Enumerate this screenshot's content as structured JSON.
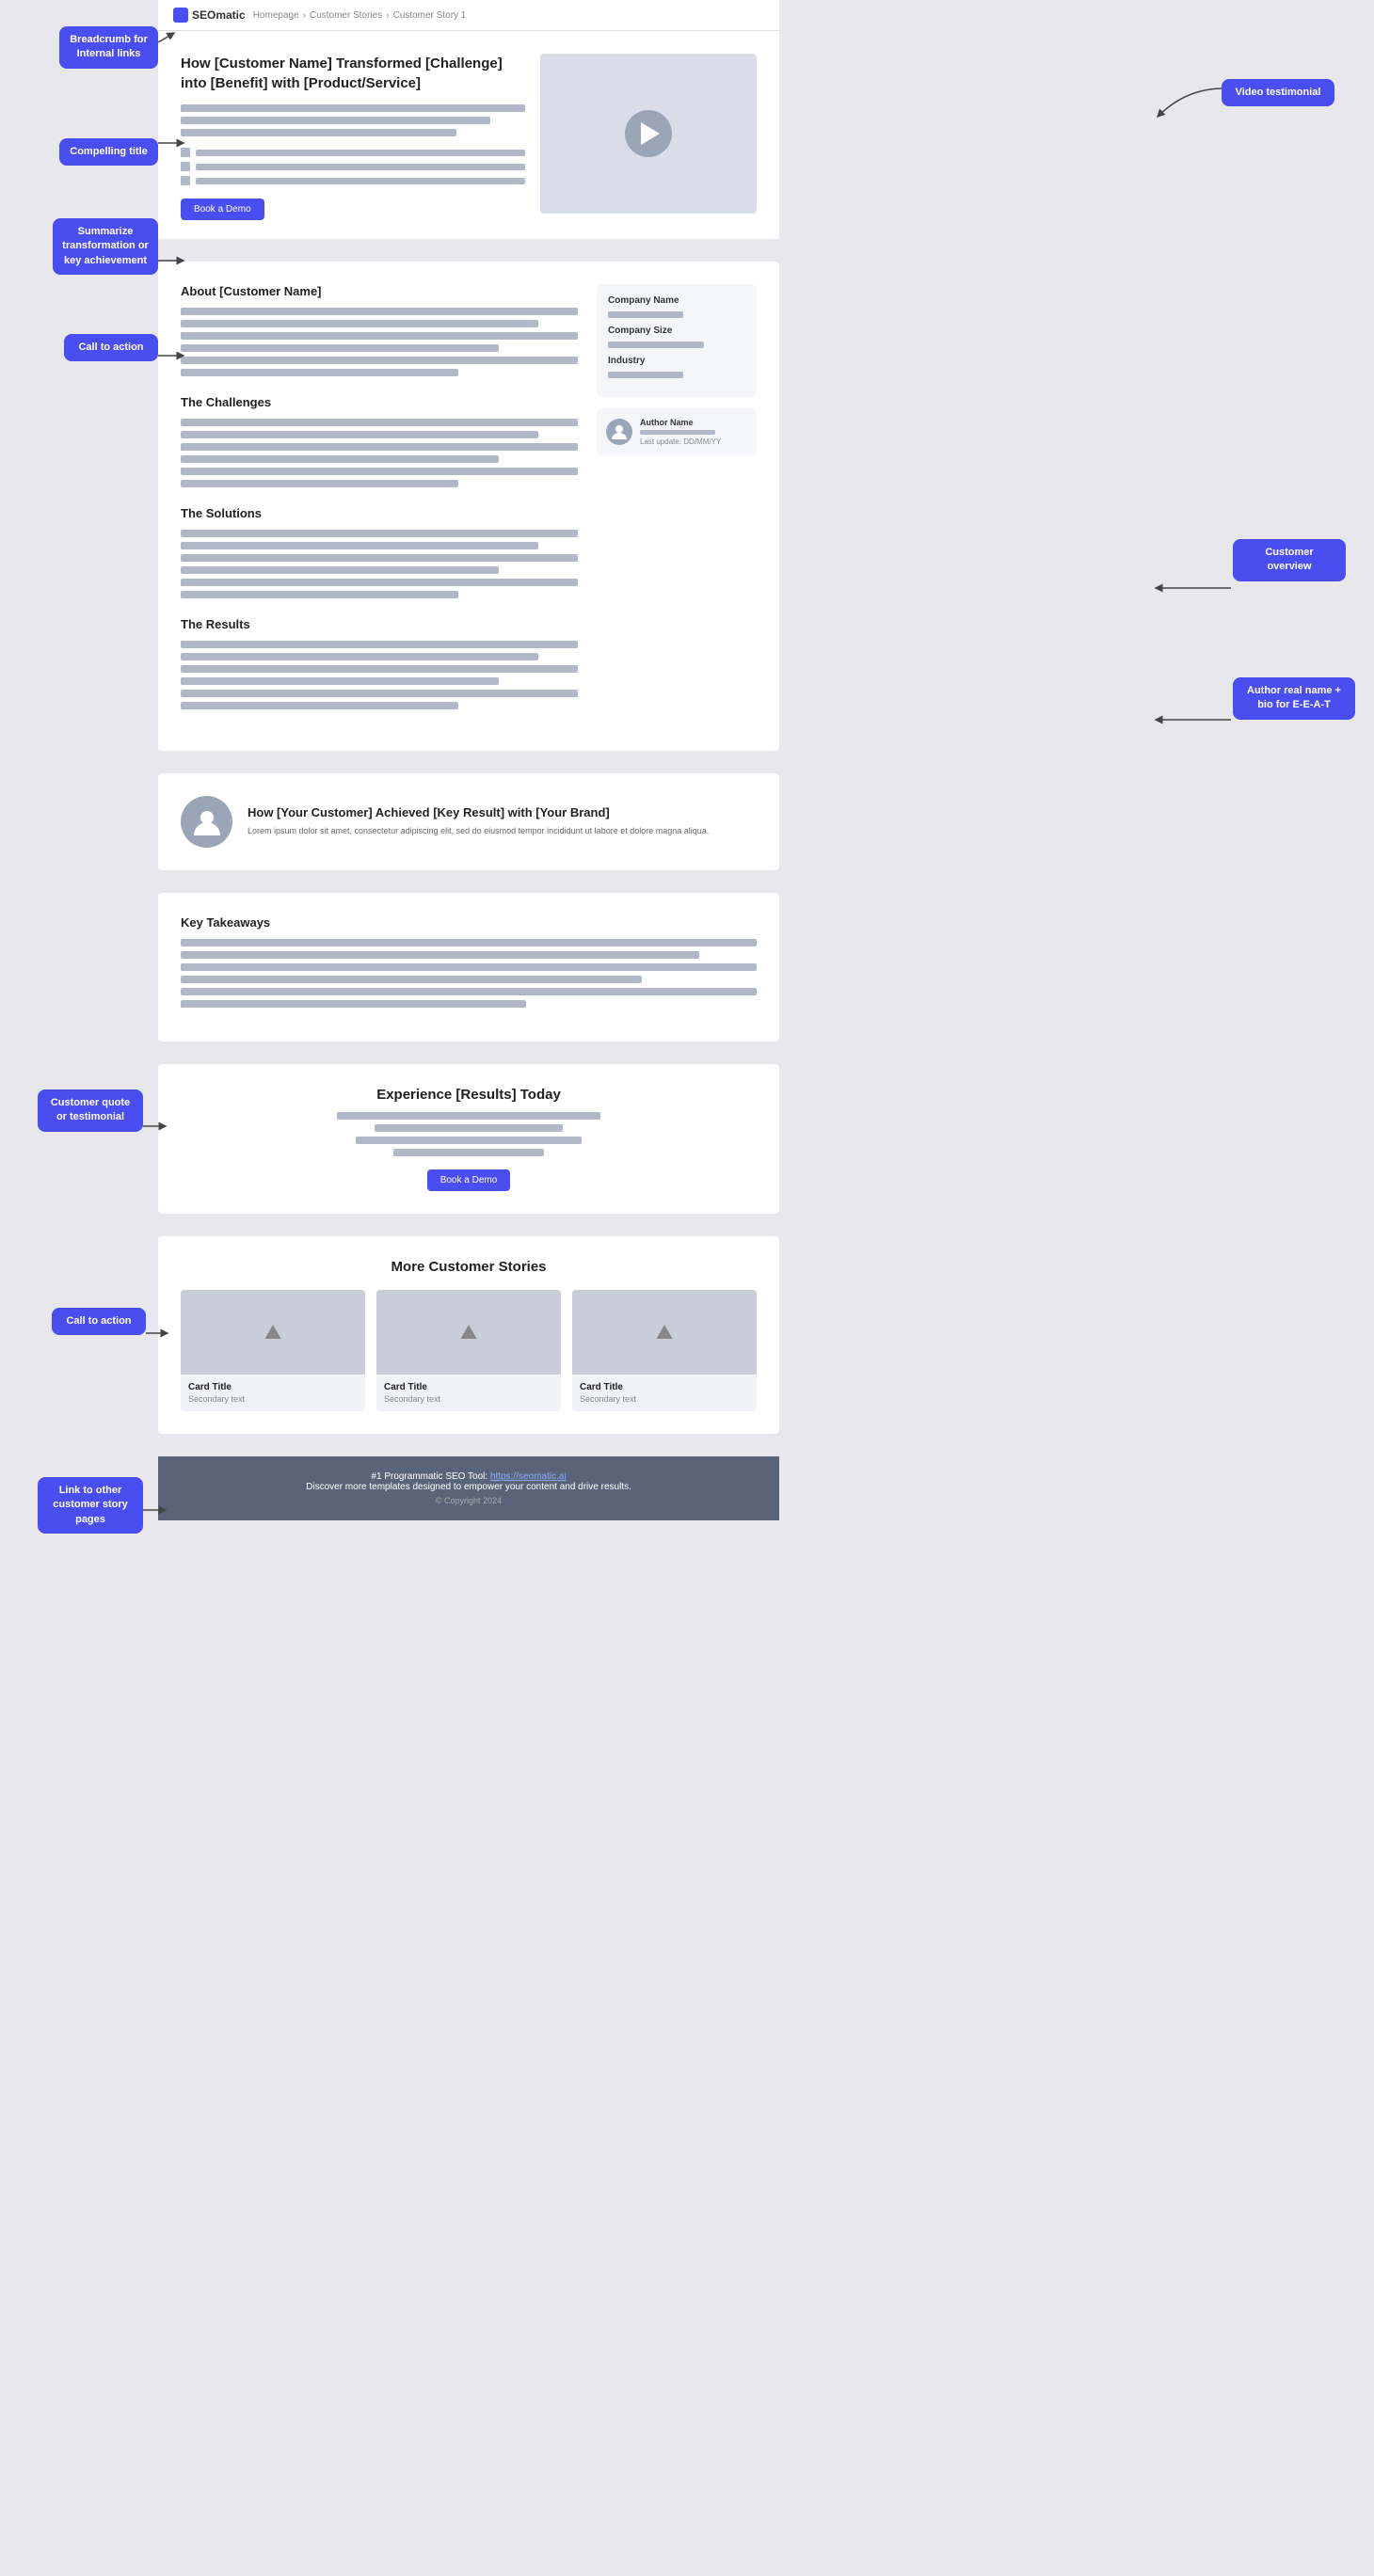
{
  "annotations": {
    "breadcrumb_label": "Breadcrumb for Internal links",
    "compelling_title_label": "Compelling title",
    "summarize_label": "Summarize transformation or key achievement",
    "cta_hero_label": "Call to action",
    "video_testimonial_label": "Video testimonial",
    "customer_overview_label": "Customer overview",
    "author_label": "Author real name + bio for E-E-A-T",
    "customer_quote_label": "Customer quote or testimonial",
    "cta_mid_label": "Call to action",
    "link_stories_label": "Link to other customer story pages"
  },
  "header": {
    "logo_text": "SEOmatic",
    "breadcrumb": [
      "Homepage",
      "Customer Stories",
      "Customer Story 1"
    ]
  },
  "hero": {
    "title": "How [Customer Name] Transformed [Challenge] into [Benefit] with [Product/Service]",
    "cta_button": "Book a Demo"
  },
  "about_section": {
    "title": "About [Customer Name]",
    "company_name_label": "Company Name",
    "company_size_label": "Company Size",
    "industry_label": "Industry"
  },
  "challenges_section": {
    "title": "The Challenges"
  },
  "solutions_section": {
    "title": "The Solutions"
  },
  "results_section": {
    "title": "The Results"
  },
  "author": {
    "name": "Author Name",
    "update": "Last update: DD/MM/YY"
  },
  "testimonial": {
    "title": "How [Your Customer] Achieved [Key Result] with [Your Brand]",
    "text": "Lorem ipsum dolor sit amet, consectetur adipiscing elit, sed do eiusmod tempor incididunt ut labore et dolore magna aliqua."
  },
  "takeaways": {
    "title": "Key Takeaways"
  },
  "cta_section": {
    "title": "Experience [Results] Today",
    "button": "Book a Demo"
  },
  "more_stories": {
    "title": "More Customer Stories",
    "cards": [
      {
        "title": "Card Title",
        "secondary": "Secondary text"
      },
      {
        "title": "Card Title",
        "secondary": "Secondary text"
      },
      {
        "title": "Card Title",
        "secondary": "Secondary text"
      }
    ]
  },
  "footer": {
    "main_text": "#1 Programmatic SEO Tool: ",
    "link_text": "https://seomatic.ai",
    "sub_text": "Discover more templates designed to empower your content and drive results.",
    "copyright": "© Copyright 2024"
  }
}
